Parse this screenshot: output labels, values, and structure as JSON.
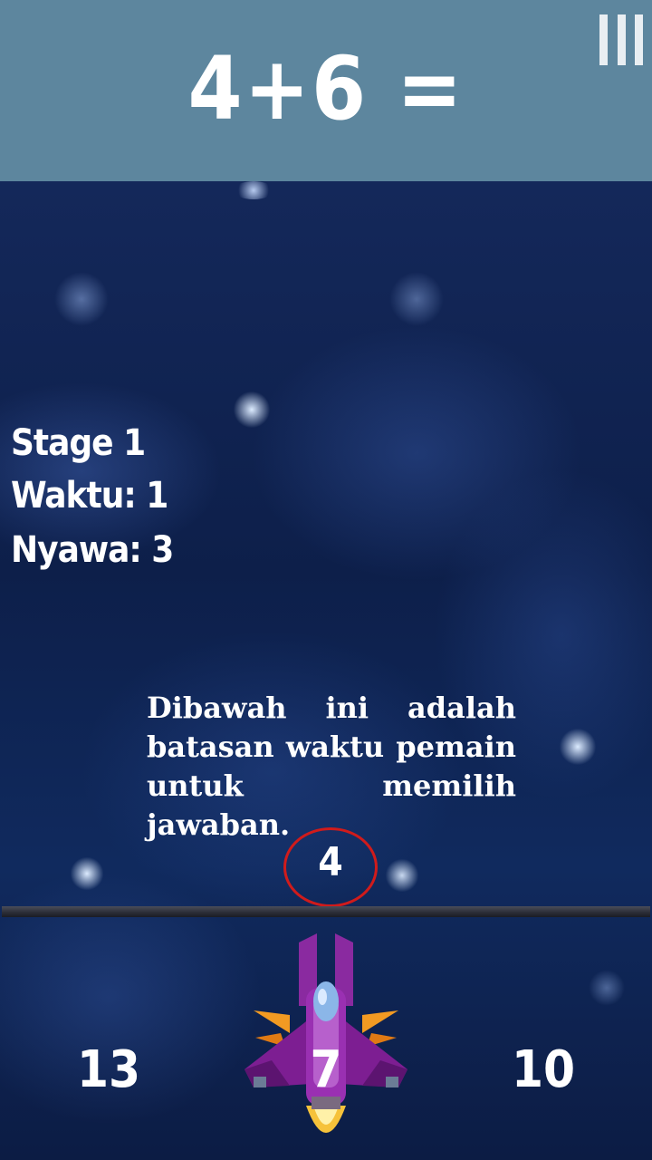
{
  "header": {
    "equation": "4+6 =",
    "menu_icon": "menu-bars-icon"
  },
  "hud": {
    "stage": "Stage 1",
    "time": "Waktu: 1",
    "lives": "Nyawa: 3"
  },
  "tutorial": {
    "line1": "Dibawah ini adalah batasan waktu pemain untuk memilih jawaban."
  },
  "timer": {
    "value": "4",
    "ring_color": "#d01b1b"
  },
  "answers": {
    "left": "13",
    "center": "7",
    "right": "10"
  },
  "player": {
    "icon": "spaceship-icon"
  },
  "colors": {
    "header_bg": "#5d869e",
    "text": "#ffffff"
  }
}
